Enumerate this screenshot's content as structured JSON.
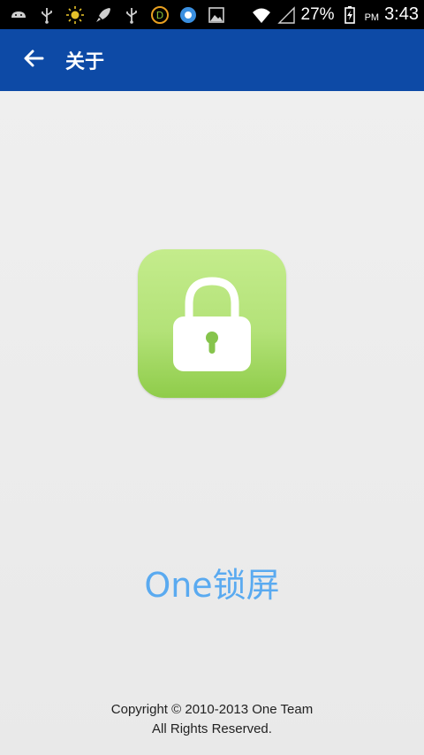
{
  "status_bar": {
    "battery_percent": "27%",
    "time_ampm": "PM",
    "time": "3:43",
    "icons": [
      "android-icon",
      "usb-icon",
      "brightness-icon",
      "rocket-icon",
      "usb-icon",
      "d-app-icon",
      "q-app-icon",
      "image-icon",
      "wifi-icon",
      "signal-icon",
      "battery-charging-icon"
    ]
  },
  "action_bar": {
    "title": "关于",
    "back_icon": "arrow-left-icon",
    "color": "#0d4aa6"
  },
  "main": {
    "app_icon": "padlock-icon",
    "app_name": "One锁屏",
    "app_name_color": "#5aaaf0",
    "copyright_line1": "Copyright © 2010-2013 One Team",
    "copyright_line2": "All Rights Reserved."
  }
}
